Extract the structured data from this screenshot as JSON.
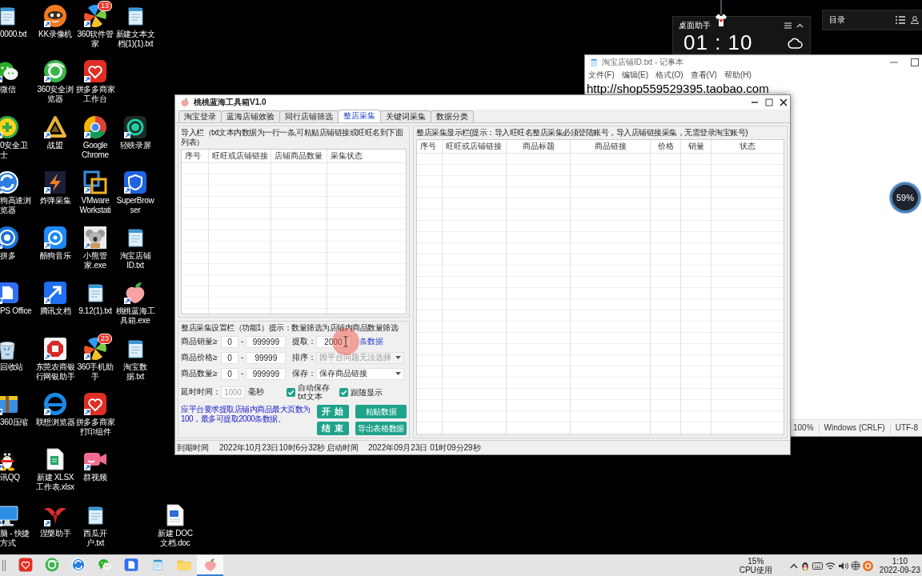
{
  "desktop_icons": [
    {
      "label": "0000.txt"
    },
    {
      "label": "微信"
    },
    {
      "label": "0安全卫士"
    },
    {
      "label": "狗高速浏览器"
    },
    {
      "label": "拼多"
    },
    {
      "label": "PS Office"
    },
    {
      "label": "回收站"
    },
    {
      "label": "360压缩"
    },
    {
      "label": "讯QQ"
    },
    {
      "label": "脑 - 快捷方式"
    },
    {
      "label": "KK录像机"
    },
    {
      "label": "360安全浏览器"
    },
    {
      "label": "战盟"
    },
    {
      "label": "炸弹采集"
    },
    {
      "label": "酷狗音乐"
    },
    {
      "label": "腾讯文档"
    },
    {
      "label": "东莞农商银行网银助手"
    },
    {
      "label": "联想浏览器"
    },
    {
      "label": "新建 XLSX 工作表.xlsx"
    },
    {
      "label": "涅槃助手"
    },
    {
      "label": "360软件管家",
      "badge": "13"
    },
    {
      "label": "拼多多商家工作台"
    },
    {
      "label": "Google Chrome"
    },
    {
      "label": "VMware Workstati"
    },
    {
      "label": "小熊管家.exe"
    },
    {
      "label": "9.12(1).txt"
    },
    {
      "label": "360手机助手",
      "badge": "23"
    },
    {
      "label": "拼多多商家打印组件"
    },
    {
      "label": "群视频"
    },
    {
      "label": "西瓜开户.txt"
    },
    {
      "label": "新建文本文档(1)(1).txt"
    },
    {
      "label": "轻映录屏"
    },
    {
      "label": "SuperBrowser"
    },
    {
      "label": "淘宝店铺ID.txt"
    },
    {
      "label": "桃桃蓝海工具箱.exe"
    },
    {
      "label": "淘宝数据.txt"
    },
    {
      "label": "新建 DOC 文档.doc"
    }
  ],
  "desktop_helper": {
    "title": "桌面助手",
    "time": "01 : 10"
  },
  "catalog_widget": {
    "title": "目录"
  },
  "usage_ball": {
    "reading": "59%"
  },
  "notepad": {
    "title": "淘宝店铺ID.txt - 记事本",
    "menu": [
      "文件(F)",
      "编辑(E)",
      "格式(O)",
      "查看(V)",
      "帮助(H)"
    ],
    "content": "http://shop559529395.taobao.com",
    "status_bar": [
      "100%",
      "Windows (CRLF)",
      "UTF-8"
    ]
  },
  "app": {
    "title": "桃桃蓝海工具箱V1.0",
    "tabs": [
      {
        "label": "淘宝登录",
        "selected": false
      },
      {
        "label": "蓝海店铺效验",
        "selected": false
      },
      {
        "label": "同行店铺筛选",
        "selected": false
      },
      {
        "label": "整店采集",
        "selected": true
      },
      {
        "label": "关键词采集",
        "selected": false
      },
      {
        "label": "数据分类",
        "selected": false
      }
    ],
    "import_panel": {
      "title": "导入栏（txt文本内数据为一行一条,可粘贴店铺链接或旺旺名到下面列表）",
      "columns": [
        "序号",
        "旺旺或店铺链接",
        "店铺商品数量",
        "采集状态"
      ]
    },
    "results_panel": {
      "title": "整店采集显示栏(提示：导入旺旺名整店采集必须登陆账号，导入店铺链接采集，无需登录淘宝账号)",
      "columns": [
        "序号",
        "旺旺或店铺链接",
        "商品标题",
        "商品链接",
        "价格",
        "销量",
        "状态"
      ]
    },
    "settings_panel": {
      "title": "整店采集设置栏（功能1）提示：数量筛选为店铺内商品数量筛选",
      "filters": [
        {
          "label": "商品销量≥",
          "min": "0",
          "separator": "-",
          "max": "999999"
        },
        {
          "label": "商品价格≥",
          "min": "0",
          "separator": "-",
          "max": "99999"
        },
        {
          "label": "商品数量≥",
          "min": "0",
          "separator": "-",
          "max": "999999"
        }
      ],
      "extract": {
        "label": "提取：",
        "value": "2000",
        "unit": "条数据"
      },
      "sort": {
        "label": "排序：",
        "value": "因平台问题无法选择",
        "disabled": true
      },
      "save": {
        "label": "保存：",
        "value": "保存商品链接",
        "disabled": false
      },
      "delay": {
        "label": "延时时间：",
        "value": "1000",
        "unit": "毫秒",
        "disabled": true
      },
      "checkboxes": [
        {
          "label": "自动保存txt文本",
          "checked": true
        },
        {
          "label": "跟随显示",
          "checked": true
        }
      ],
      "note": "应平台要求提取店铺内商品最大页数为100，最多可提取2000条数据。",
      "buttons": [
        {
          "label": "开 始",
          "kind": "action"
        },
        {
          "label": "粘贴数据",
          "kind": "tool"
        },
        {
          "label": "结 束",
          "kind": "action"
        },
        {
          "label": "导出表格数据",
          "kind": "tool"
        }
      ]
    },
    "status_bar": [
      {
        "label": "到期时间",
        "value": "2022年10月23日10时6分32秒"
      },
      {
        "label": "启动时间",
        "value": "2022年09月23日 01时09分29秒"
      }
    ]
  },
  "taskbar": {
    "apps": [
      {
        "active": false
      },
      {
        "active": false
      },
      {
        "active": false
      },
      {
        "active": false
      },
      {
        "active": false
      },
      {
        "active": false
      },
      {
        "active": false
      },
      {
        "active": true
      }
    ],
    "cpu": {
      "value": "15%",
      "label": "CPU使用"
    },
    "clock": {
      "time": "1:10",
      "date": "2022-09-23"
    }
  }
}
